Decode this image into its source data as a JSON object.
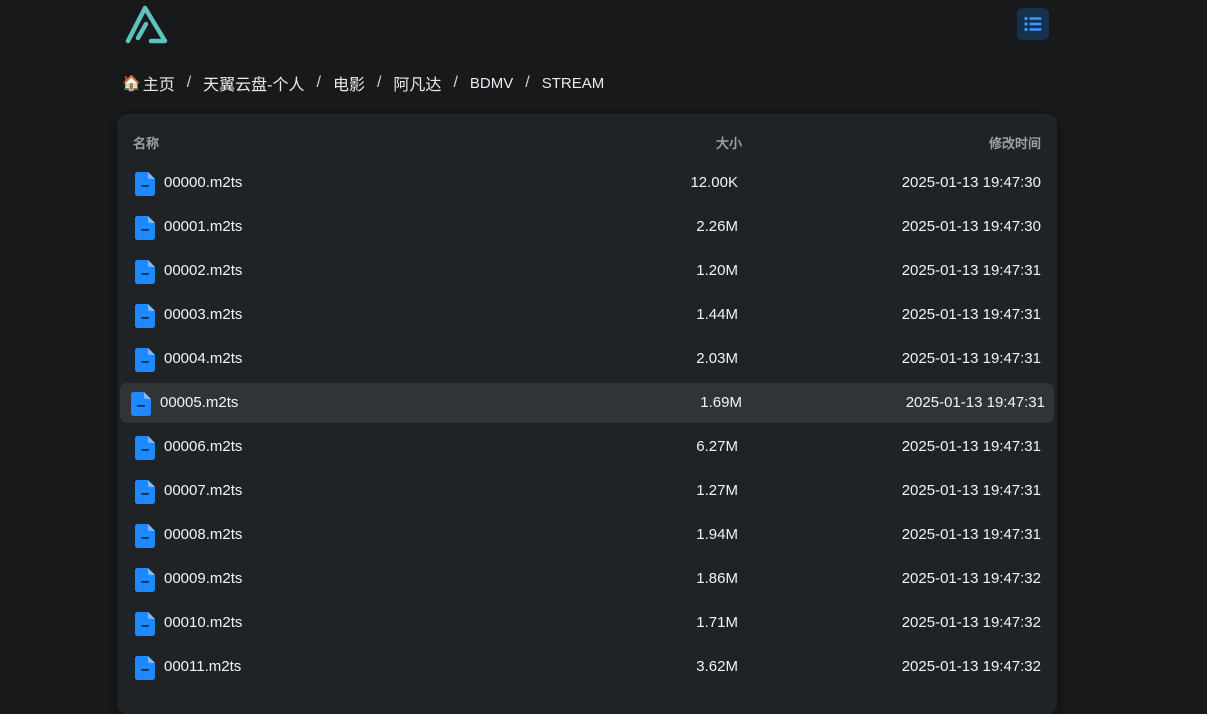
{
  "colors": {
    "accent": "#1e88ff",
    "logo": "#5cc4bd",
    "menu_bg": "#15314f"
  },
  "header": {
    "logo_icon": "alist-logo-icon",
    "menu_icon": "list-icon"
  },
  "breadcrumb": {
    "home_icon": "🏠",
    "items": [
      "主页",
      "天翼云盘-个人",
      "电影",
      "阿凡达",
      "BDMV",
      "STREAM"
    ],
    "separator": "/"
  },
  "table": {
    "headers": {
      "name": "名称",
      "size": "大小",
      "modified": "修改时间"
    },
    "rows": [
      {
        "name": "00000.m2ts",
        "size": "12.00K",
        "modified": "2025-01-13 19:47:30"
      },
      {
        "name": "00001.m2ts",
        "size": "2.26M",
        "modified": "2025-01-13 19:47:30"
      },
      {
        "name": "00002.m2ts",
        "size": "1.20M",
        "modified": "2025-01-13 19:47:31"
      },
      {
        "name": "00003.m2ts",
        "size": "1.44M",
        "modified": "2025-01-13 19:47:31"
      },
      {
        "name": "00004.m2ts",
        "size": "2.03M",
        "modified": "2025-01-13 19:47:31"
      },
      {
        "name": "00005.m2ts",
        "size": "1.69M",
        "modified": "2025-01-13 19:47:31"
      },
      {
        "name": "00006.m2ts",
        "size": "6.27M",
        "modified": "2025-01-13 19:47:31"
      },
      {
        "name": "00007.m2ts",
        "size": "1.27M",
        "modified": "2025-01-13 19:47:31"
      },
      {
        "name": "00008.m2ts",
        "size": "1.94M",
        "modified": "2025-01-13 19:47:31"
      },
      {
        "name": "00009.m2ts",
        "size": "1.86M",
        "modified": "2025-01-13 19:47:32"
      },
      {
        "name": "00010.m2ts",
        "size": "1.71M",
        "modified": "2025-01-13 19:47:32"
      },
      {
        "name": "00011.m2ts",
        "size": "3.62M",
        "modified": "2025-01-13 19:47:32"
      }
    ]
  }
}
